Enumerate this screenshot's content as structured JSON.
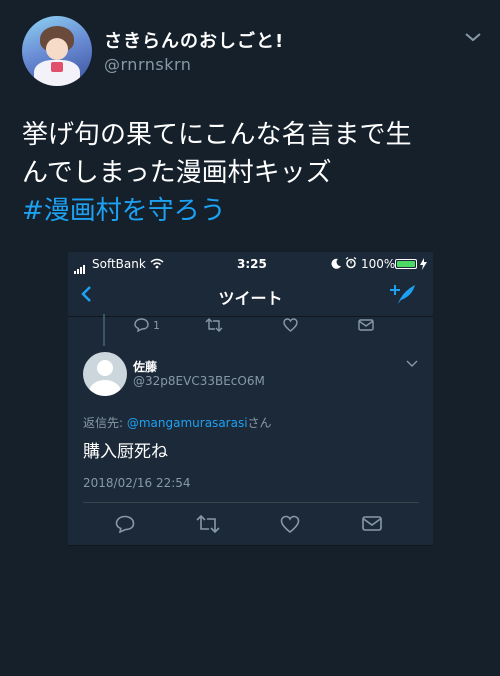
{
  "tweet": {
    "display_name": "さきらんのおしごと!",
    "handle": "@rnrnskrn",
    "text_line1": "挙げ句の果てにこんな名言まで生",
    "text_line2": "んでしまった漫画村キッズ",
    "hashtag": "#漫画村を守ろう"
  },
  "phone": {
    "status": {
      "carrier": "SoftBank",
      "time": "3:25",
      "battery": "100%"
    },
    "nav_title": "ツイート",
    "previous_tweet_reply_count": "1",
    "reply": {
      "name": "佐藤",
      "handle": "@32p8EVC33BEcO6M",
      "replying_prefix": "返信先: ",
      "replying_mention": "@mangamurasarasi",
      "replying_suffix": "さん",
      "body": "購入厨死ね",
      "date": "2018/02/16 22:54"
    }
  },
  "colors": {
    "background": "#15202b",
    "accent": "#1da1f2",
    "muted": "#8899a6"
  }
}
